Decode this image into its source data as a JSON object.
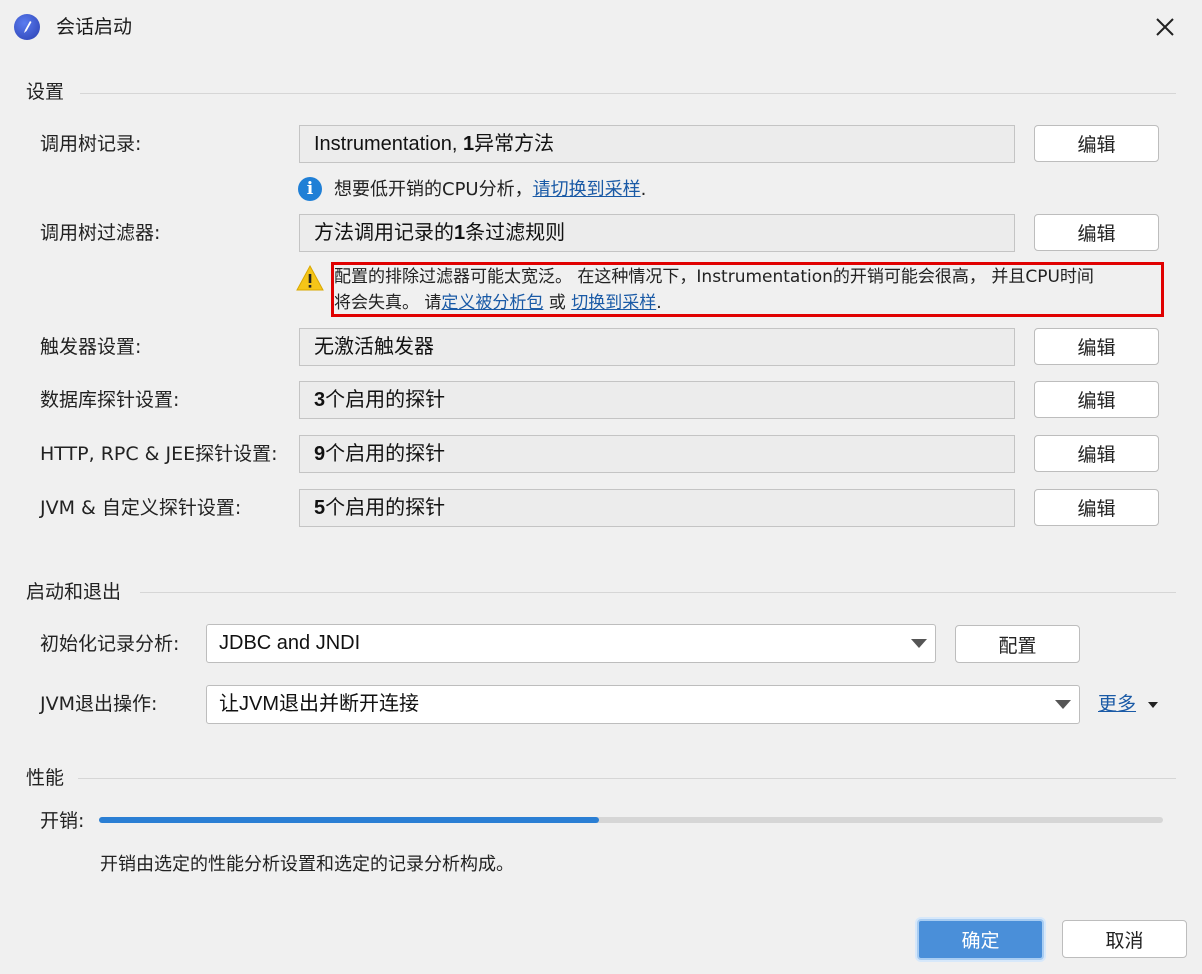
{
  "window": {
    "title": "会话启动"
  },
  "settings": {
    "heading": "设置",
    "rows": [
      {
        "label": "调用树记录:",
        "value_bold": "",
        "value": "Instrumentation, ",
        "value_bold2": "1",
        "value_tail": "异常方法",
        "button": "编辑"
      },
      {
        "label": "调用树过滤器:",
        "value_lead": "方法调用记录的",
        "value_bold": "1",
        "value_tail": "条过滤规则",
        "button": "编辑"
      },
      {
        "label": "触发器设置:",
        "value": "无激活触发器",
        "button": "编辑"
      },
      {
        "label": "数据库探针设置:",
        "value_bold": "3",
        "value_tail": "个启用的探针",
        "button": "编辑"
      },
      {
        "label": "HTTP, RPC & JEE探针设置:",
        "value_bold": "9",
        "value_tail": "个启用的探针",
        "button": "编辑"
      },
      {
        "label": "JVM & 自定义探针设置:",
        "value_bold": "5",
        "value_tail": "个启用的探针",
        "button": "编辑"
      }
    ],
    "info_note": {
      "text": "想要低开销的CPU分析，",
      "link": "请切换到采样",
      "tail": "."
    },
    "warning": {
      "line1": "配置的排除过滤器可能太宽泛。 在这种情况下，Instrumentation的开销可能会很高， 并且CPU时间",
      "line2_lead": "将会失真。 请",
      "link1": "定义被分析包",
      "mid": " 或 ",
      "link2": "切换到采样",
      "tail": "."
    }
  },
  "startup": {
    "heading": "启动和退出",
    "init_label": "初始化记录分析:",
    "init_value": "JDBC and JNDI",
    "configure_button": "配置",
    "exit_label": "JVM退出操作:",
    "exit_value": "让JVM退出并断开连接",
    "more_link": "更多"
  },
  "performance": {
    "heading": "性能",
    "overhead_label": "开销:",
    "overhead_fraction": 0.47,
    "description": "开销由选定的性能分析设置和选定的记录分析构成。"
  },
  "footer": {
    "ok": "确定",
    "cancel": "取消"
  },
  "colors": {
    "accent": "#2b7fd4",
    "warning_border": "#e00000",
    "link": "#1a5aa6"
  },
  "icons": [
    "app-logo-icon",
    "close-icon",
    "info-icon",
    "warning-icon",
    "chevron-down-icon"
  ]
}
